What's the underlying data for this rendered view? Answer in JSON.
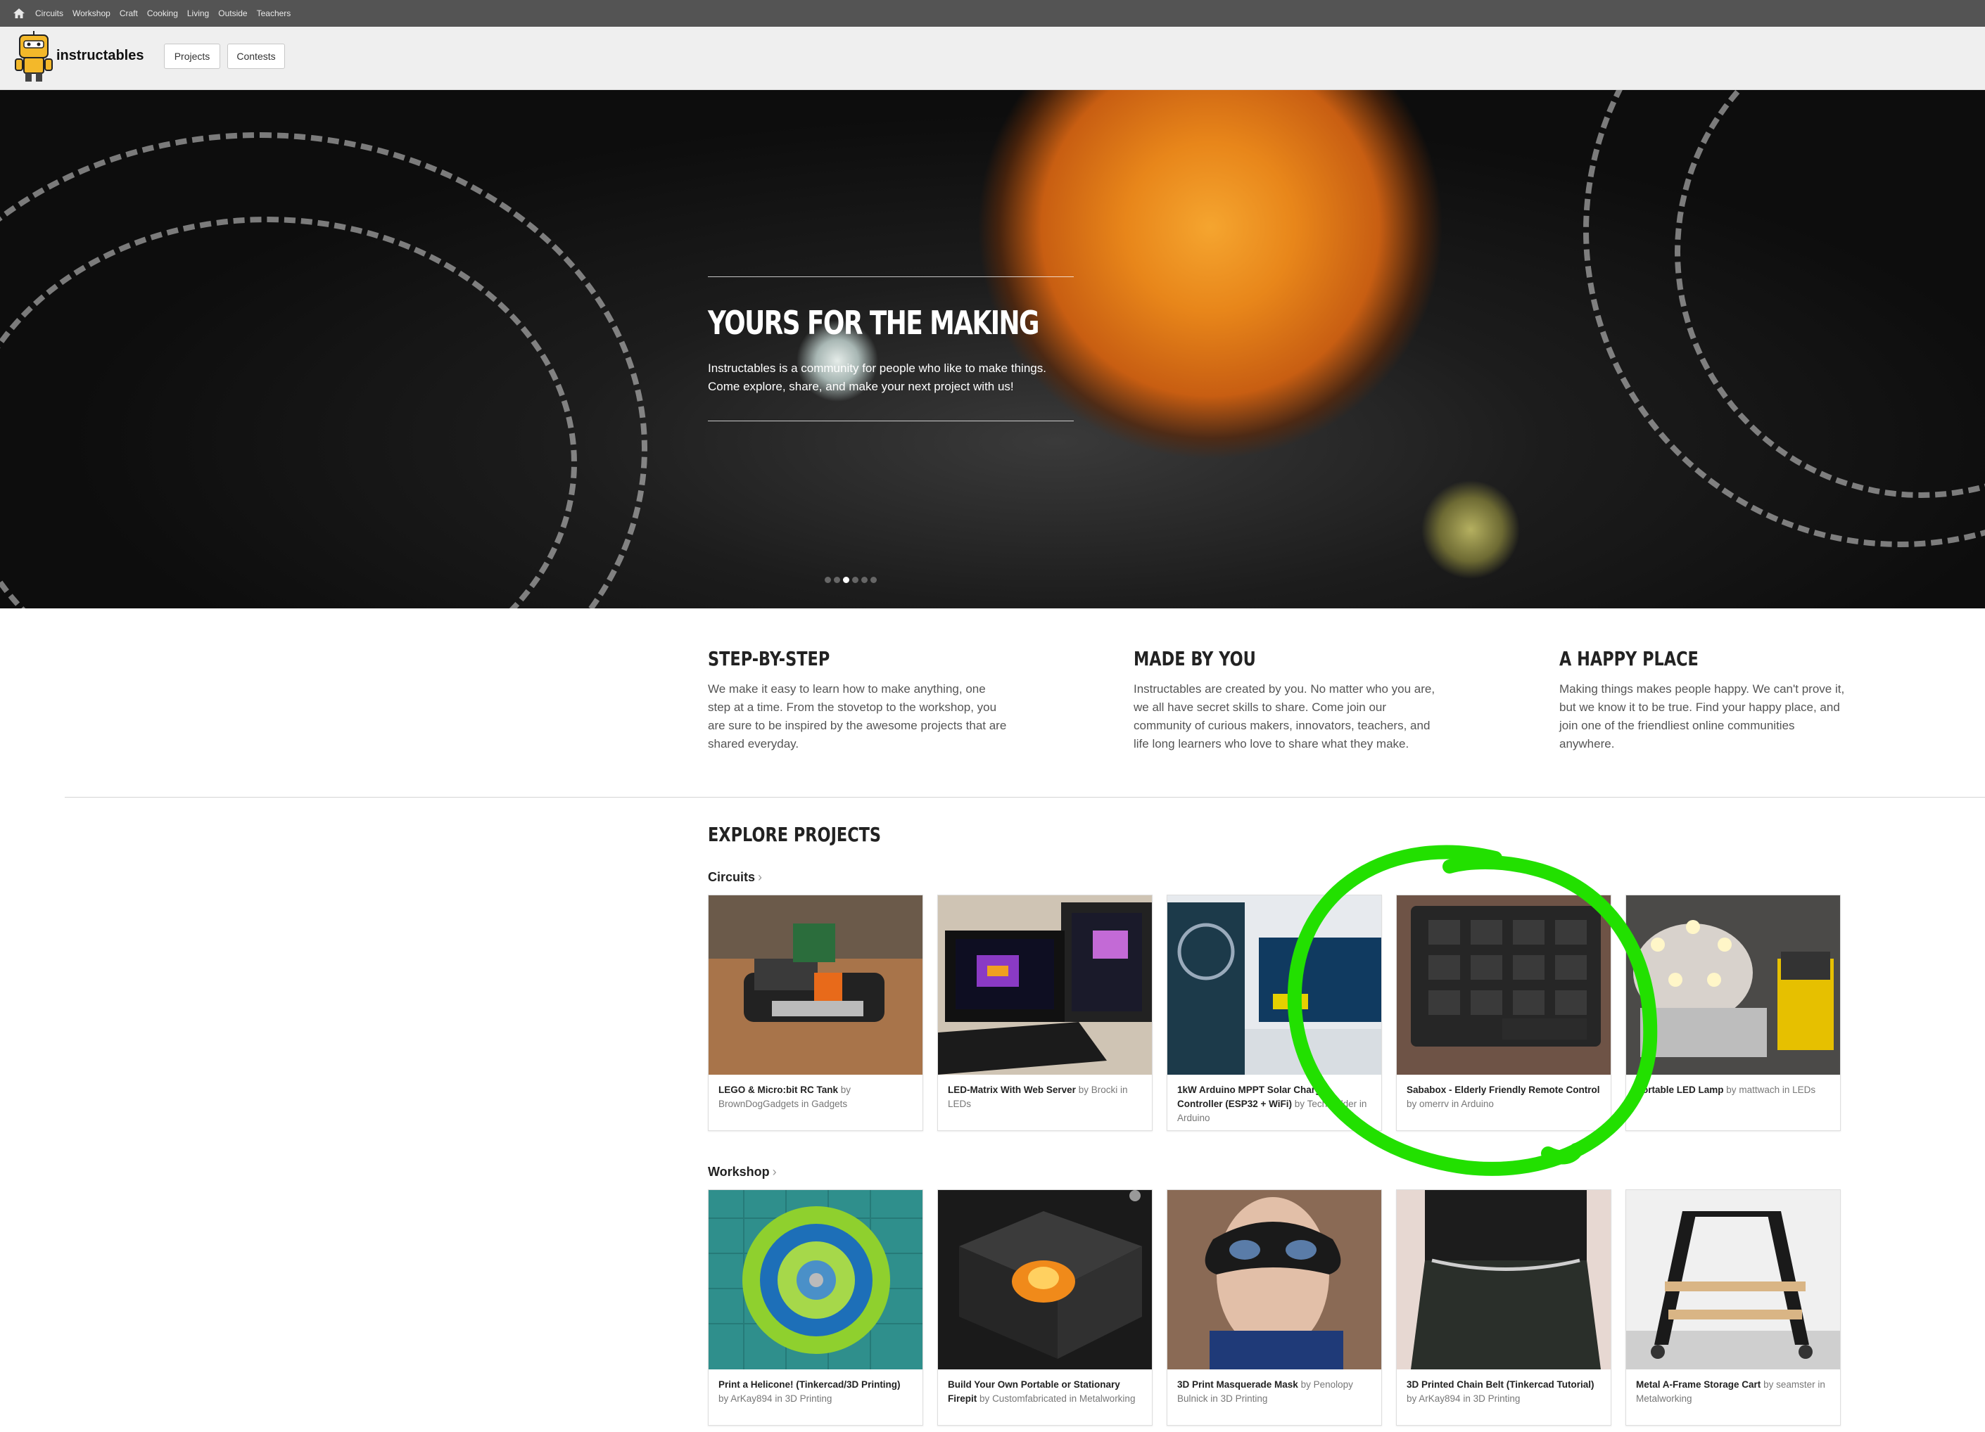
{
  "topbar": {
    "categories": [
      "Circuits",
      "Workshop",
      "Craft",
      "Cooking",
      "Living",
      "Outside",
      "Teachers"
    ]
  },
  "header": {
    "logo_text": "instructables",
    "nav": [
      "Projects",
      "Contests"
    ]
  },
  "hero": {
    "title": "YOURS FOR THE MAKING",
    "line1": "Instructables is a community for people who like to make things.",
    "line2": "Come explore, share, and make your next project with us!",
    "slides": 6,
    "active_slide": 3
  },
  "features": [
    {
      "title": "STEP-BY-STEP",
      "text": "We make it easy to learn how to make anything, one step at a time. From the stovetop to the workshop, you are sure to be inspired by the awesome projects that are shared everyday."
    },
    {
      "title": "MADE BY YOU",
      "text": "Instructables are created by you. No matter who you are, we all have secret skills to share. Come join our community of curious makers, innovators, teachers, and life long learners who love to share what they make."
    },
    {
      "title": "A HAPPY PLACE",
      "text": "Making things makes people happy. We can't prove it, but we know it to be true. Find your happy place, and join one of the friendliest online communities anywhere."
    }
  ],
  "explore": {
    "title": "EXPLORE PROJECTS",
    "sections": [
      {
        "label": "Circuits",
        "cards": [
          {
            "title": "LEGO & Micro:bit RC Tank",
            "author": "BrownDogGadgets",
            "category": "Gadgets"
          },
          {
            "title": "LED-Matrix With Web Server",
            "author": "Brocki",
            "category": "LEDs"
          },
          {
            "title": "1kW Arduino MPPT Solar Charge Controller (ESP32 + WiFi)",
            "author": "TechBuilder",
            "category": "Arduino"
          },
          {
            "title": "Sababox - Elderly Friendly Remote Control",
            "author": "omerrv",
            "category": "Arduino"
          },
          {
            "title": "Portable LED Lamp",
            "author": "mattwach",
            "category": "LEDs"
          }
        ]
      },
      {
        "label": "Workshop",
        "cards": [
          {
            "title": "Print a Helicone! (Tinkercad/3D Printing)",
            "author": "ArKay894",
            "category": "3D Printing"
          },
          {
            "title": "Build Your Own Portable or Stationary Firepit",
            "author": "Customfabricated",
            "category": "Metalworking"
          },
          {
            "title": "3D Print Masquerade Mask",
            "author": "Penolopy Bulnick",
            "category": "3D Printing"
          },
          {
            "title": "3D Printed Chain Belt (Tinkercad Tutorial)",
            "author": "ArKay894",
            "category": "3D Printing"
          },
          {
            "title": "Metal A-Frame Storage Cart",
            "author": "seamster",
            "category": "Metalworking"
          }
        ]
      }
    ]
  },
  "words": {
    "by": "by",
    "in": "in",
    "chevron": "›"
  },
  "colors": {
    "annotation": "#22e000",
    "topbar": "#545454",
    "header": "#efefef"
  }
}
